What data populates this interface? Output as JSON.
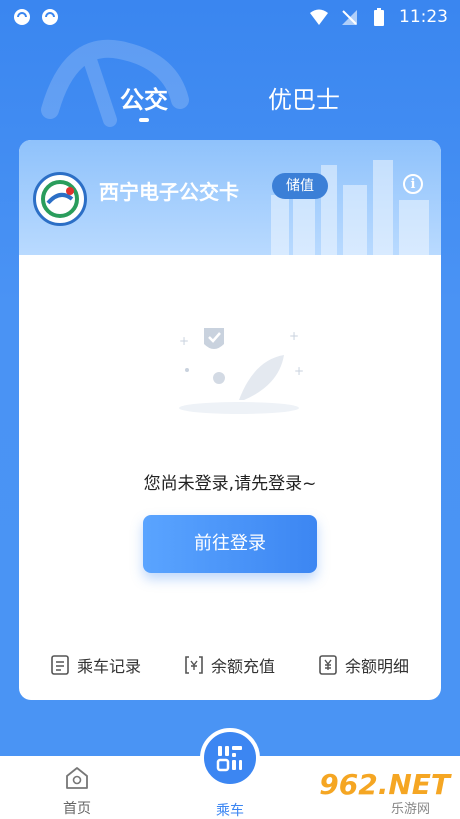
{
  "status_bar": {
    "time": "11:23"
  },
  "top_tabs": [
    {
      "label": "公交",
      "active": true
    },
    {
      "label": "优巴士",
      "active": false
    }
  ],
  "card": {
    "title": "西宁电子公交卡",
    "badge": "储值",
    "info_icon": "info-icon",
    "empty_message": "您尚未登录,请先登录~",
    "login_button": "前往登录",
    "actions": [
      {
        "label": "乘车记录",
        "icon": "list-icon"
      },
      {
        "label": "余额充值",
        "icon": "recharge-icon"
      },
      {
        "label": "余额明细",
        "icon": "yen-detail-icon"
      }
    ]
  },
  "bottom_nav": {
    "home": "首页",
    "ride": "乘车"
  },
  "watermark": {
    "main": "962.NET",
    "sub": "乐游网"
  },
  "colors": {
    "primary": "#3c86f2",
    "header": "#8fc2fb",
    "badge": "#3b7fd7"
  }
}
